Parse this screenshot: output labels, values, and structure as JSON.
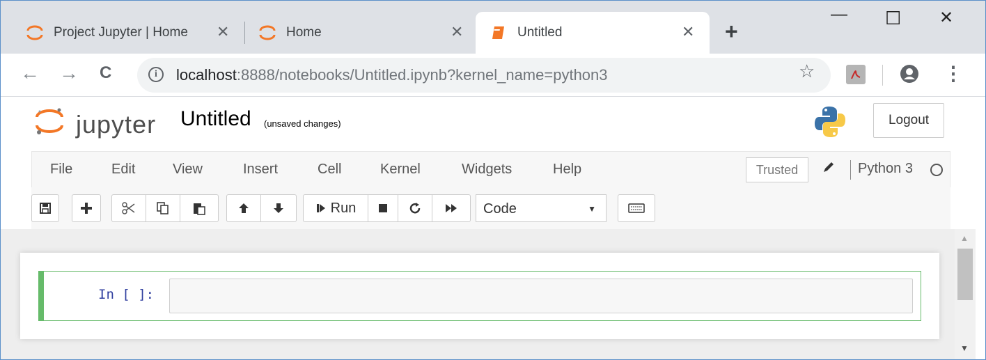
{
  "browser": {
    "tabs": [
      {
        "title": "Project Jupyter | Home",
        "icon": "jupyter-logo-icon",
        "active": false
      },
      {
        "title": "Home",
        "icon": "jupyter-logo-icon",
        "active": false
      },
      {
        "title": "Untitled",
        "icon": "notebook-icon",
        "active": true
      }
    ],
    "close_glyph": "✕",
    "new_tab_glyph": "+",
    "window_controls": {
      "minimize": "—",
      "maximize": "☐",
      "close": "✕"
    },
    "nav": {
      "back": "←",
      "forward": "→",
      "reload": "C"
    },
    "address": {
      "host": "localhost",
      "rest": ":8888/notebooks/Untitled.ipynb?kernel_name=python3"
    },
    "info_glyph": "i",
    "star_glyph": "☆",
    "menu_glyph": "⋮"
  },
  "jupyter": {
    "wordmark": "jupyter",
    "notebook_title": "Untitled",
    "save_status": "(unsaved changes)",
    "logout_label": "Logout",
    "menu": [
      "File",
      "Edit",
      "View",
      "Insert",
      "Cell",
      "Kernel",
      "Widgets",
      "Help"
    ],
    "trusted_label": "Trusted",
    "kernel_name": "Python 3",
    "toolbar": {
      "run_label": "Run",
      "cell_type": "Code"
    },
    "cell": {
      "prompt": "In [ ]:",
      "content": ""
    },
    "colors": {
      "jupyter_orange": "#f37726",
      "cell_selected_border": "#66bb6a",
      "prompt_blue": "#303f9f"
    }
  }
}
